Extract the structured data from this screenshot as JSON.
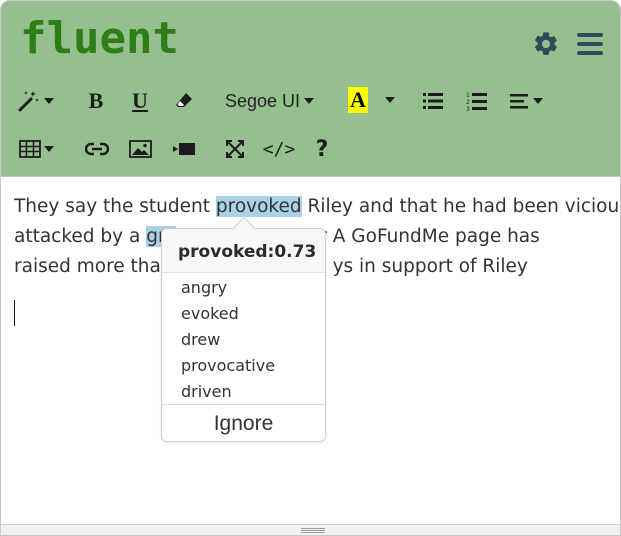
{
  "app": {
    "title": "fluent"
  },
  "header": {
    "settings_icon": "gear-icon",
    "menu_icon": "hamburger-icon"
  },
  "toolbar": {
    "row1": [
      {
        "name": "magic-wand-dropdown",
        "icon": "magic-wand-icon"
      },
      {
        "name": "bold-button",
        "label": "B"
      },
      {
        "name": "underline-button",
        "label": "U"
      },
      {
        "name": "eraser-button",
        "icon": "eraser-icon"
      },
      {
        "name": "font-family-select",
        "value": "Segoe UI"
      },
      {
        "name": "text-color-button",
        "label": "A",
        "color": "#ffff00"
      },
      {
        "name": "unordered-list-button",
        "icon": "bullet-list-icon"
      },
      {
        "name": "ordered-list-button",
        "icon": "numbered-list-icon"
      },
      {
        "name": "align-dropdown",
        "icon": "align-left-icon"
      }
    ],
    "row2": [
      {
        "name": "table-dropdown",
        "icon": "table-icon"
      },
      {
        "name": "link-button",
        "icon": "link-icon"
      },
      {
        "name": "image-button",
        "icon": "image-icon"
      },
      {
        "name": "video-button",
        "icon": "video-icon"
      },
      {
        "name": "fullscreen-button",
        "icon": "fullscreen-icon"
      },
      {
        "name": "code-view-button",
        "label": "</>"
      },
      {
        "name": "help-button",
        "label": "?"
      }
    ],
    "font_value": "Segoe UI",
    "bold_label": "B",
    "underline_label": "U",
    "color_label": "A",
    "code_label": "</>",
    "help_label": "?"
  },
  "editor": {
    "line1": {
      "before": "They say the student ",
      "highlight": "provoked",
      "after": " Riley and that he had been viciously"
    },
    "line2": {
      "before": "attacked by a ",
      "highlight": "gro",
      "after": "t year A GoFundMe page has"
    },
    "line3": {
      "before": "raised more than",
      "after": "ys in support of Riley"
    }
  },
  "suggestion_popup": {
    "word": "provoked",
    "score": "0.73",
    "heading": "provoked:0.73",
    "suggestions": [
      "angry",
      "evoked",
      "drew",
      "provocative",
      "driven"
    ],
    "ignore_label": "Ignore"
  },
  "colors": {
    "header_bg": "#96bf8f",
    "logo": "#2e7d17",
    "highlight": "#a9d2e6",
    "text_color_swatch": "#ffff00"
  }
}
